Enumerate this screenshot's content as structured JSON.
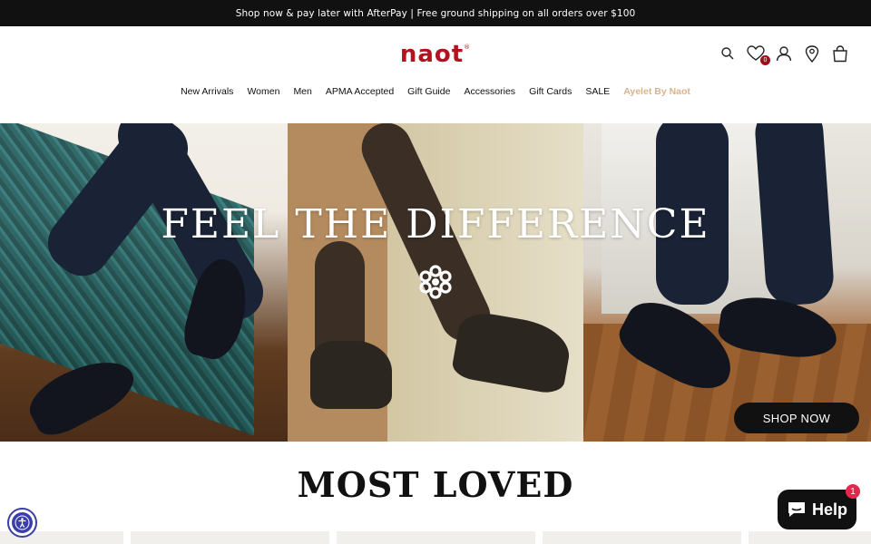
{
  "announcement": {
    "text": "Shop now & pay later with AfterPay | Free ground shipping on all orders over $100"
  },
  "header": {
    "logo_text": "naot",
    "logo_mark": "®",
    "brand_color": "#b3121f",
    "icons": [
      "search-icon",
      "wishlist-icon",
      "account-icon",
      "store-locator-icon",
      "cart-icon"
    ],
    "wishlist_count": "0"
  },
  "nav": {
    "items": [
      {
        "label": "New Arrivals"
      },
      {
        "label": "Women"
      },
      {
        "label": "Men"
      },
      {
        "label": "APMA Accepted"
      },
      {
        "label": "Gift Guide"
      },
      {
        "label": "Accessories"
      },
      {
        "label": "Gift Cards"
      },
      {
        "label": "SALE"
      },
      {
        "label": "Ayelet By Naot"
      }
    ],
    "accent_color": "#d8b48d"
  },
  "hero": {
    "title": "FEEL THE DIFFERENCE",
    "cta_label": "SHOP NOW"
  },
  "section": {
    "title": "MOST LOVED"
  },
  "widgets": {
    "help_label": "Help",
    "help_badge_count": "1",
    "accessibility_icon": "accessibility-icon"
  }
}
